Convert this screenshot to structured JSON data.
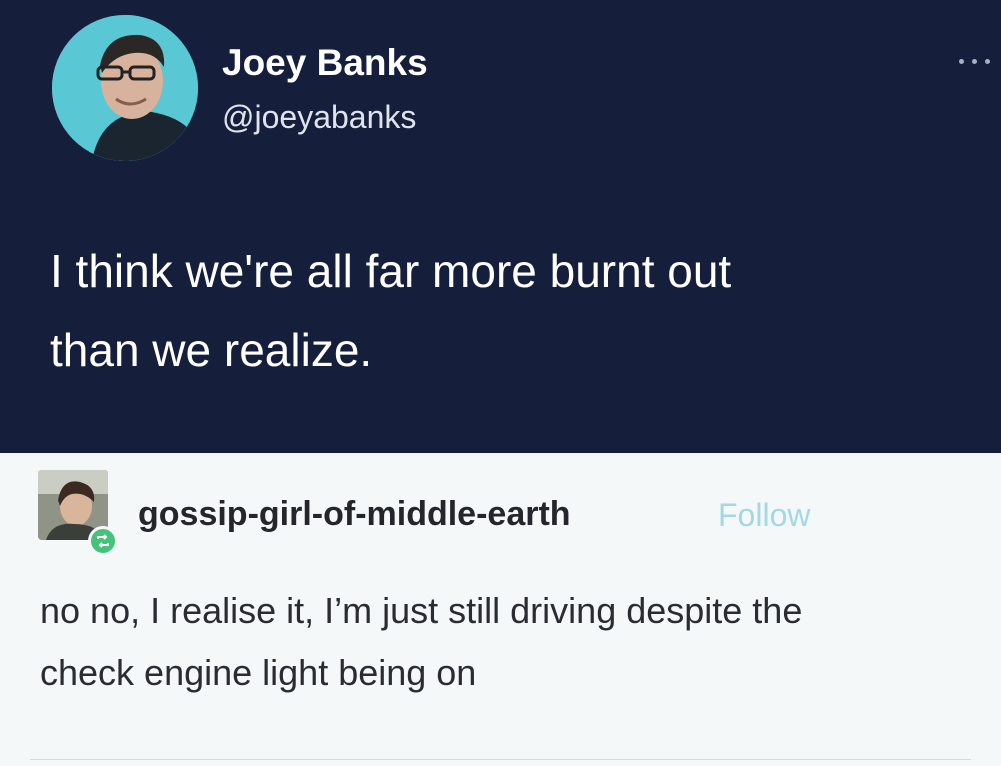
{
  "tweet": {
    "author_name": "Joey Banks",
    "author_handle": "@joeyabanks",
    "text_lines": [
      "I think we're all far more burnt out",
      "than we realize."
    ],
    "colors": {
      "background": "#151e3a",
      "text": "#ffffff",
      "avatar_bg": "#59c7d4"
    },
    "more_icon": "more-horizontal-icon"
  },
  "reblog": {
    "username": "gossip-girl-of-middle-earth",
    "follow_label": "Follow",
    "text_lines": [
      "no no, I realise it, I’m just still driving despite the",
      "check engine light being on"
    ],
    "colors": {
      "background": "#f4f8f9",
      "follow": "#a3d9e4",
      "badge": "#46c37b"
    },
    "badge_icon": "reblog-icon"
  }
}
